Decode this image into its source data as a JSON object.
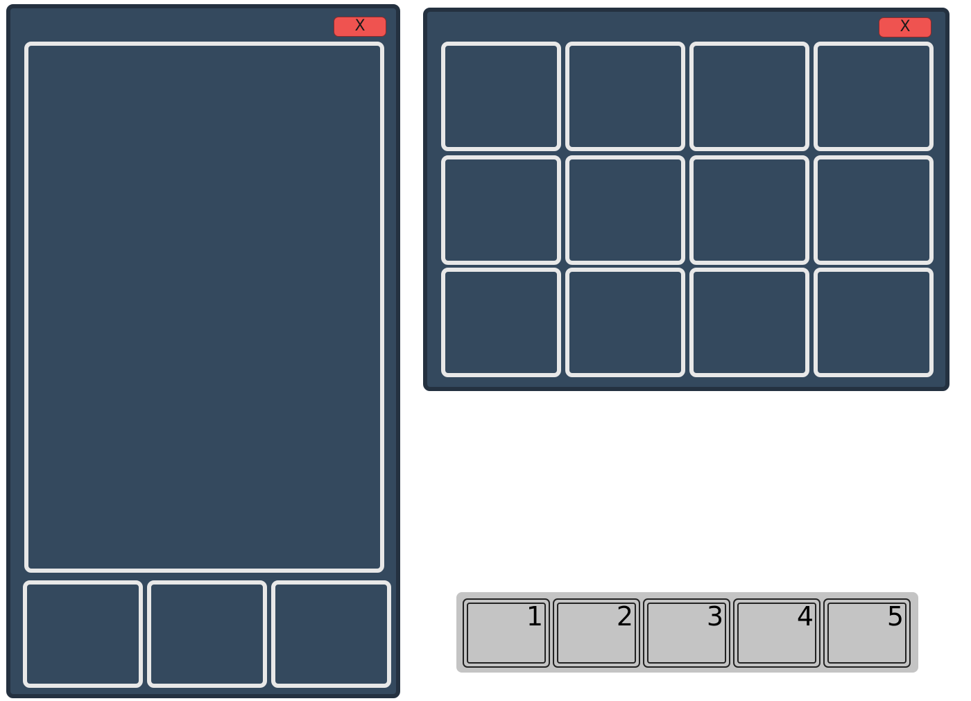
{
  "left_panel": {
    "close_label": "X",
    "main_slot_count": 1,
    "bottom_slot_count": 3
  },
  "right_panel": {
    "close_label": "X",
    "grid_rows": 3,
    "grid_cols": 4
  },
  "hotbar": {
    "slots": [
      {
        "label": "1"
      },
      {
        "label": "2"
      },
      {
        "label": "3"
      },
      {
        "label": "4"
      },
      {
        "label": "5"
      }
    ]
  },
  "colors": {
    "panel_bg": "#34495e",
    "panel_border": "#243140",
    "slot_border": "#e8e8e8",
    "close_button": "#ef5350",
    "hotbar_bg": "#c4c4c4"
  }
}
